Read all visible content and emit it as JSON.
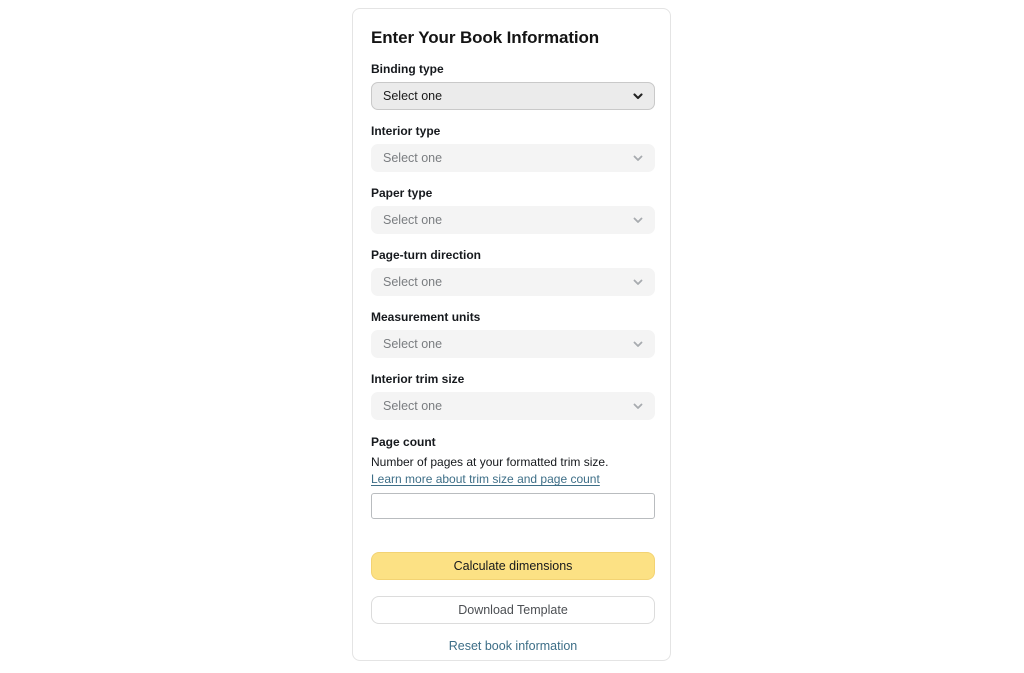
{
  "card": {
    "title": "Enter Your Book Information",
    "fields": [
      {
        "label": "Binding type",
        "value": "Select one",
        "state": "enabled",
        "icon": "chevron-down-icon",
        "name": "binding-type"
      },
      {
        "label": "Interior type",
        "value": "Select one",
        "state": "disabled",
        "icon": "chevron-down-icon",
        "name": "interior-type"
      },
      {
        "label": "Paper type",
        "value": "Select one",
        "state": "disabled",
        "icon": "chevron-down-icon",
        "name": "paper-type"
      },
      {
        "label": "Page-turn direction",
        "value": "Select one",
        "state": "disabled",
        "icon": "chevron-down-icon",
        "name": "page-turn-direction"
      },
      {
        "label": "Measurement units",
        "value": "Select one",
        "state": "disabled",
        "icon": "chevron-down-icon",
        "name": "measurement-units"
      },
      {
        "label": "Interior trim size",
        "value": "Select one",
        "state": "disabled",
        "icon": "chevron-down-icon",
        "name": "interior-trim-size"
      }
    ],
    "page_count": {
      "label": "Page count",
      "description": "Number of pages at your formatted trim size.",
      "link_text": "Learn more about trim size and page count",
      "input_value": "",
      "input_placeholder": ""
    },
    "actions": {
      "calculate_label": "Calculate dimensions",
      "download_label": "Download Template",
      "reset_label": "Reset book information"
    }
  },
  "colors": {
    "page_background": "#ffffff",
    "card_background": "#ffffff",
    "card_border": "#e4e4e4",
    "title_text": "#141414",
    "label_text": "#16191d",
    "select_enabled_background": "#ebebeb",
    "select_enabled_border": "#c9c9c9",
    "select_disabled_background": "#f4f4f4",
    "select_disabled_text": "#7a7d80",
    "link_teal": "#3d6e87",
    "calculate_button_background": "#fce184",
    "calculate_button_border": "#f3d373",
    "download_button_border": "#dcdcdc"
  }
}
